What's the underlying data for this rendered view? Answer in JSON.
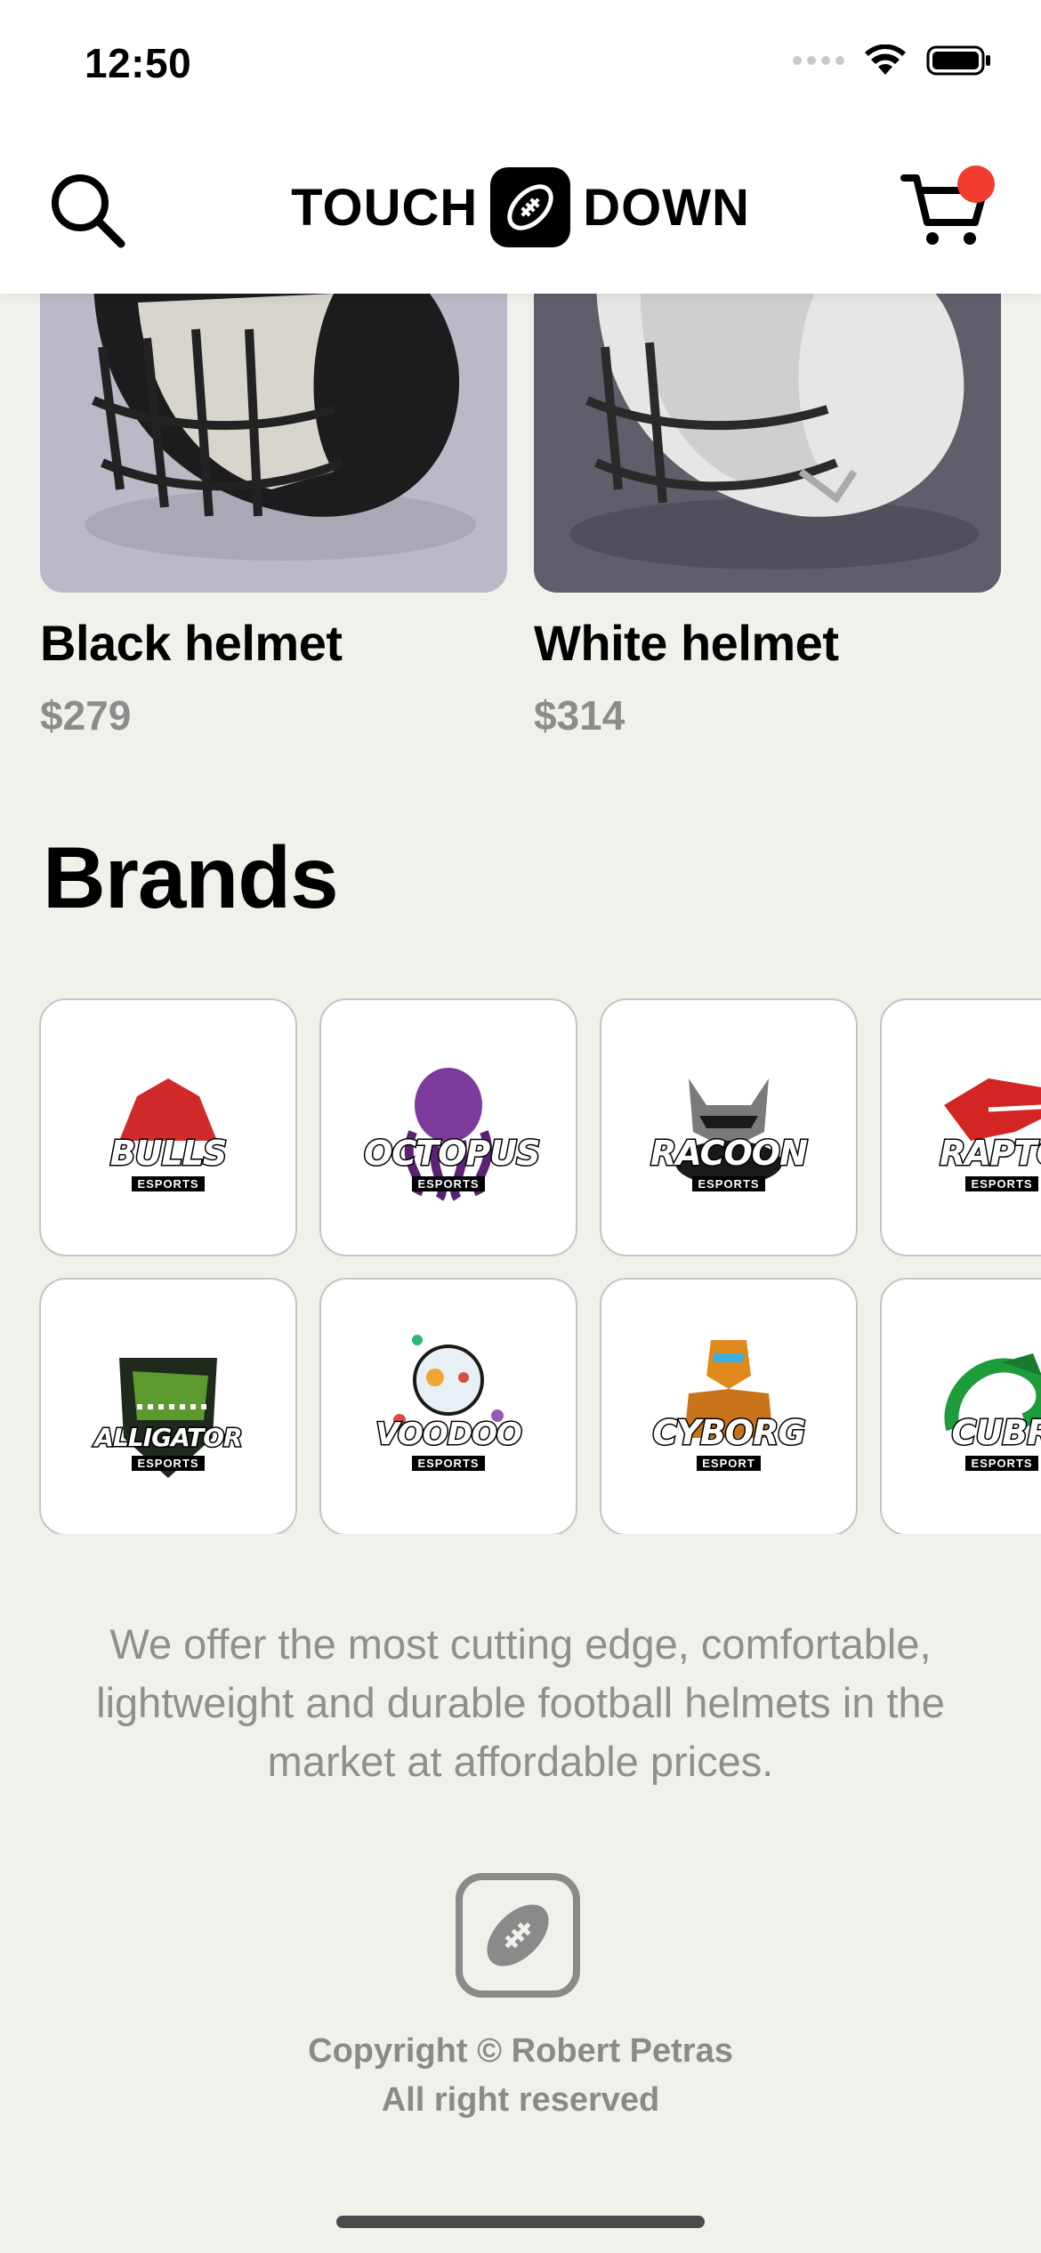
{
  "status_bar": {
    "time": "12:50"
  },
  "header": {
    "logo_left": "TOUCH",
    "logo_right": "DOWN"
  },
  "products": [
    {
      "name": "Black helmet",
      "price": "$279",
      "bg": "#b9b9c7"
    },
    {
      "name": "White helmet",
      "price": "$314",
      "bg": "#5e5f6b"
    }
  ],
  "brands": {
    "title": "Brands",
    "items": [
      {
        "name": "BULLS",
        "sub": "ESPORTS",
        "color": "#d12a2a"
      },
      {
        "name": "OCTOPUS",
        "sub": "ESPORTS",
        "color": "#7c3a9c"
      },
      {
        "name": "RACOON",
        "sub": "ESPORTS",
        "color": "#6e6e6e"
      },
      {
        "name": "RAPTO",
        "sub": "ESPORTS",
        "color": "#d42525"
      },
      {
        "name": "ALLIGATOR",
        "sub": "ESPORTS",
        "color": "#4f8a2a"
      },
      {
        "name": "VOODOO",
        "sub": "ESPORTS",
        "color": "#9fc4d8"
      },
      {
        "name": "CYBORG",
        "sub": "ESPORT",
        "color": "#e08a1e"
      },
      {
        "name": "CUBR",
        "sub": "ESPORTS",
        "color": "#1e9c3c"
      }
    ]
  },
  "about": {
    "text": "We offer the most cutting edge, comfortable, lightweight and durable football helmets in the market at affordable prices."
  },
  "footer": {
    "copyright_line1": "Copyright © Robert Petras",
    "copyright_line2": "All right reserved"
  }
}
